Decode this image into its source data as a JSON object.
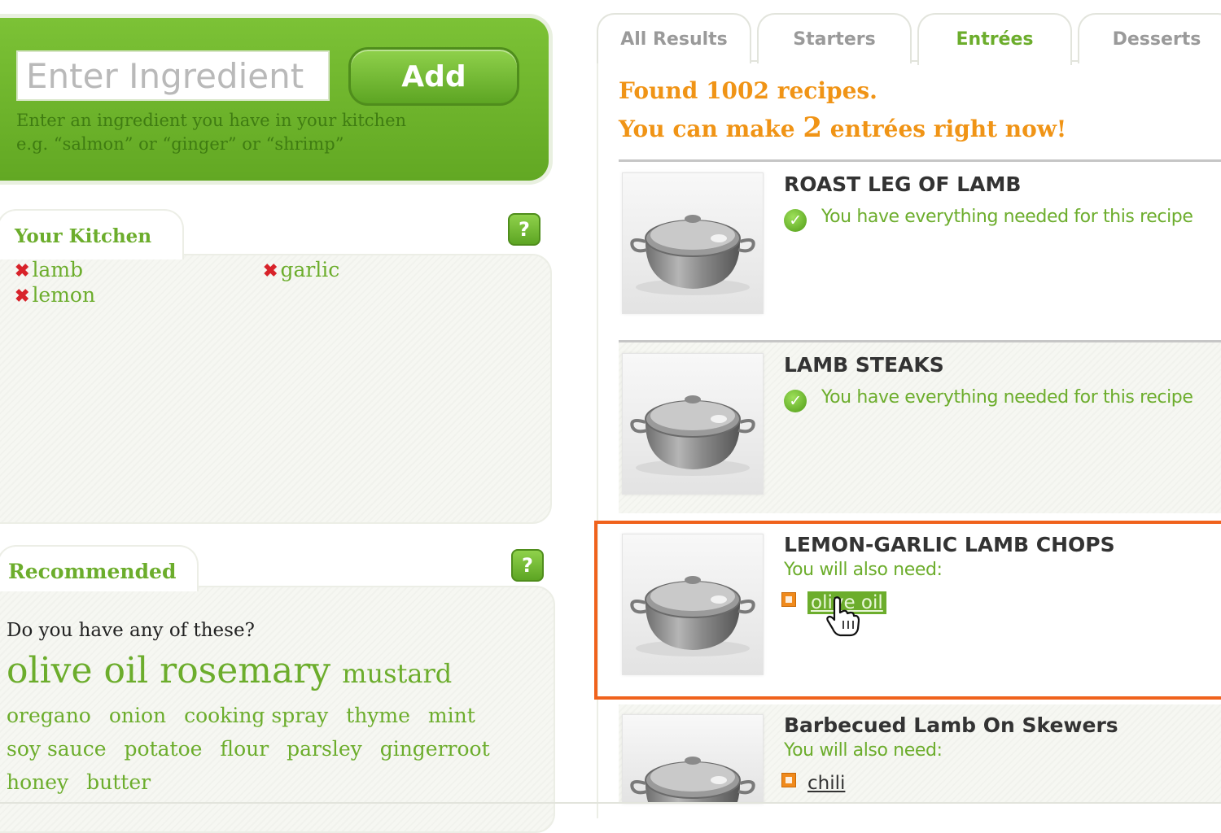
{
  "add": {
    "placeholder": "Enter Ingredient",
    "button_label": "Add",
    "hint_line1": "Enter an ingredient you have in your kitchen",
    "hint_line2": "e.g. “salmon” or “ginger” or “shrimp”"
  },
  "kitchen": {
    "title": "Your Kitchen",
    "help": "?",
    "remove_glyph": "✖",
    "items": [
      "lamb",
      "garlic",
      "lemon"
    ]
  },
  "recommended": {
    "title": "Recommended",
    "help": "?",
    "question": "Do you have any of these?",
    "large": [
      "olive oil",
      "rosemary"
    ],
    "medium": "mustard",
    "small": [
      "oregano",
      "onion",
      "cooking spray",
      "thyme",
      "mint",
      "soy sauce",
      "potatoe",
      "flour",
      "parsley",
      "gingerroot",
      "honey",
      "butter"
    ]
  },
  "tabs": [
    "All Results",
    "Starters",
    "Entrées",
    "Desserts"
  ],
  "active_tab": "Entrées",
  "summary": {
    "found": "Found 1002 recipes.",
    "make_prefix": "You can make ",
    "make_count": "2",
    "make_suffix": " entrées right now!"
  },
  "recipes": [
    {
      "title": "ROAST LEG OF LAMB",
      "status": "You have everything needed for this recipe"
    },
    {
      "title": "LAMB STEAKS",
      "status": "You have everything needed for this recipe"
    },
    {
      "title": "LEMON-GARLIC LAMB CHOPS",
      "need_label": "You will also need:",
      "need": "olive oil"
    },
    {
      "title": "Barbecued Lamb On Skewers",
      "need_label": "You will also need:",
      "need": "chili"
    }
  ],
  "colors": {
    "brand_green": "#6cad2c",
    "accent_orange": "#f09416",
    "highlight": "#f0621c",
    "remove_red": "#d8232a"
  },
  "icons": [
    "check-icon",
    "help-icon",
    "remove-icon",
    "add-icon",
    "pot-icon",
    "hand-cursor-icon"
  ]
}
